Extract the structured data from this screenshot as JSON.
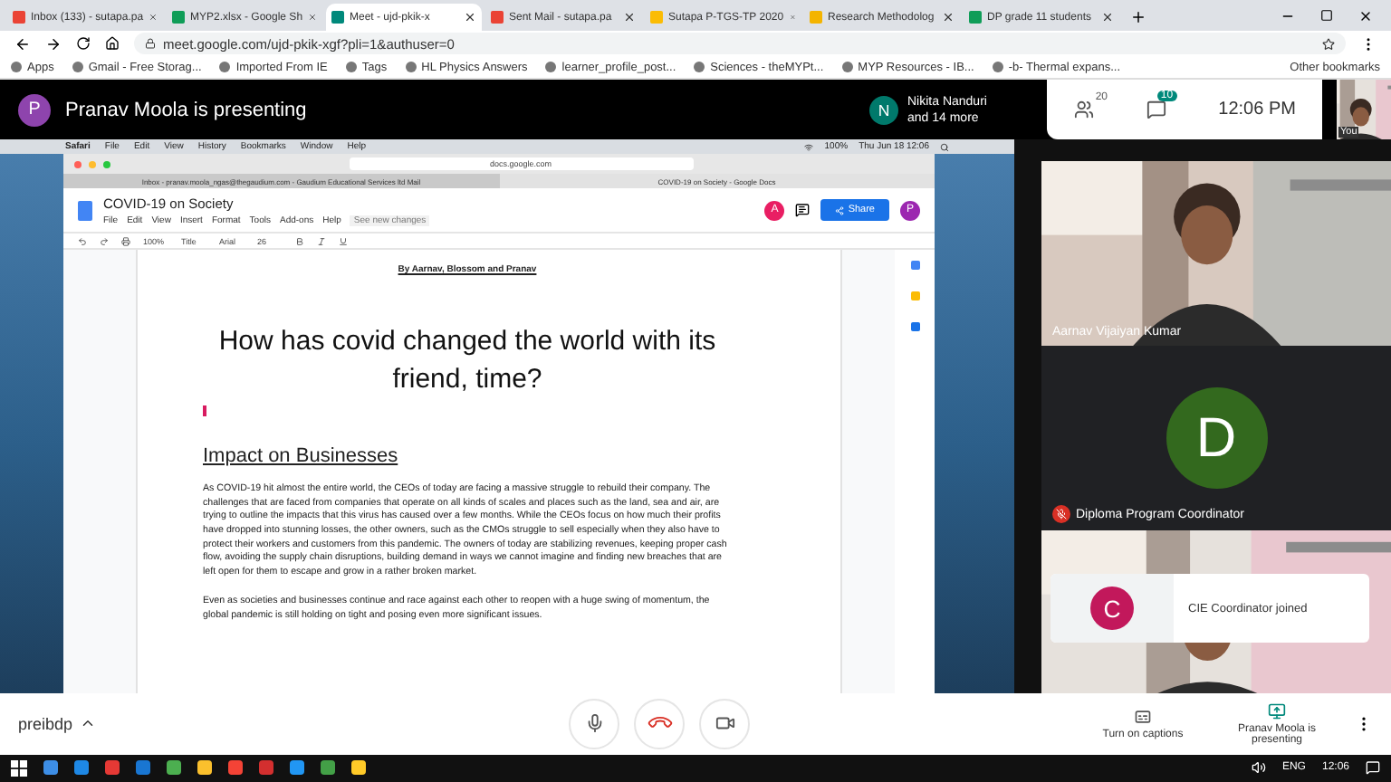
{
  "browser": {
    "tabs": [
      {
        "title": "Inbox (133) - sutapa.pa",
        "kind": "mail",
        "selected": false
      },
      {
        "title": "MYP2.xlsx - Google Sh",
        "kind": "sheet",
        "selected": false
      },
      {
        "title": "Meet - ujd-pkik-x",
        "kind": "meet",
        "selected": true
      },
      {
        "title": "Sent Mail - sutapa.pa",
        "kind": "mail",
        "selected": false
      },
      {
        "title": "Sutapa P-TGS-TP 2020",
        "kind": "drive",
        "selected": false
      },
      {
        "title": "Research Methodolog",
        "kind": "slides",
        "selected": false
      },
      {
        "title": "DP grade 11 students",
        "kind": "sheet",
        "selected": false
      }
    ],
    "address": "meet.google.com/ujd-pkik-xgf?pli=1&authuser=0",
    "bookmarks": [
      "Apps",
      "Gmail - Free Storag...",
      "Imported From IE",
      "Tags",
      "HL Physics Answers",
      "learner_profile_post...",
      "Sciences - theMYPt...",
      "MYP Resources - IB...",
      "-b- Thermal expans..."
    ],
    "other_bookmarks": "Other bookmarks"
  },
  "meet_bar": {
    "presenter_avatar": "P",
    "presenter": "Pranav Moola is presenting",
    "participant_avatar": "N",
    "participant": "Nikita Nanduri",
    "more": "and 14 more",
    "people_count": "20",
    "chat_count": "10",
    "time": "12:06 PM",
    "self_label": "You"
  },
  "shared_screen": {
    "mac_menu": [
      "Safari",
      "File",
      "Edit",
      "View",
      "History",
      "Bookmarks",
      "Window",
      "Help"
    ],
    "battery": "100%",
    "clock": "Thu Jun 18 12:06",
    "safari_url": "docs.google.com",
    "safari_tabs": [
      {
        "title": "Inbox - pranav.moola_ngas@thegaudium.com - Gaudium Educational Services ltd Mail",
        "selected": false
      },
      {
        "title": "COVID-19 on Society - Google Docs",
        "selected": true
      }
    ],
    "doc_title": "COVID-19 on Society",
    "doc_menu": [
      "File",
      "Edit",
      "View",
      "Insert",
      "Format",
      "Tools",
      "Add-ons",
      "Help"
    ],
    "changes": "See new changes",
    "editor_avatar": "A",
    "share": "Share",
    "user_avatar": "P",
    "toolbar": [
      "100%",
      "Title",
      "Arial",
      "26"
    ],
    "byline": "By Aarnav, Blossom and Pranav",
    "heading": "How has covid changed the world with its friend, time?",
    "subheading": "Impact on Businesses",
    "paragraphs": [
      "As COVID-19 hit almost the entire world, the CEOs of today are facing a massive struggle to rebuild their company. The challenges that are faced from companies that operate on all kinds of scales and places such as the land, sea and air, are trying to outline the impacts that this virus has caused over a few months. While the CEOs focus on how much their profits have dropped into stunning losses, the other owners, such as the CMOs struggle to sell especially when they also have to protect their workers and customers from this pandemic. The owners of today are stabilizing revenues, keeping proper cash flow, avoiding the supply chain disruptions, building demand in ways we cannot imagine and finding new breaches that are left open for them to escape and grow in a rather broken market.",
      "Even as societies and businesses continue and race against each other to reopen with a huge swing of momentum, the global pandemic is still holding on tight and posing even more significant issues."
    ]
  },
  "tiles": [
    {
      "kind": "video",
      "name": "Aarnav Vijaiyan Kumar"
    },
    {
      "kind": "avatar",
      "initial": "D",
      "name": "Diploma Program Coordinator",
      "muted": true
    },
    {
      "kind": "video"
    }
  ],
  "toast": {
    "initial": "C",
    "text": "CIE Coordinator joined"
  },
  "bottom_bar": {
    "meeting": "preibdp",
    "captions": "Turn on captions",
    "presenting": "Pranav Moola is presenting"
  },
  "taskbar": {
    "language": "ENG",
    "time": "12:06"
  }
}
